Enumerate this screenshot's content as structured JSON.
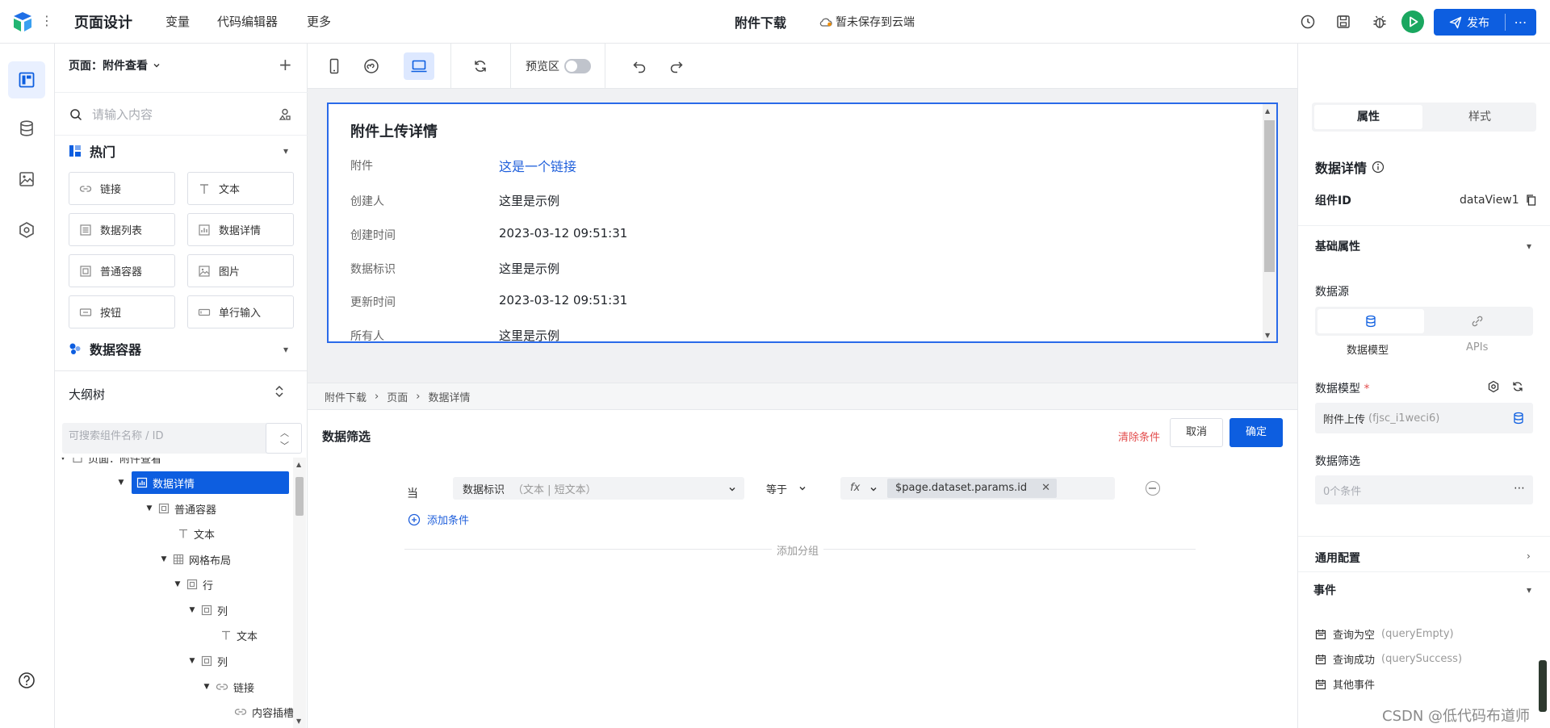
{
  "topbar": {
    "title": "页面设计",
    "menus": [
      "变量",
      "代码编辑器",
      "更多"
    ],
    "page_name": "附件下载",
    "save_status": "暂未保存到云端",
    "publish_label": "发布"
  },
  "panel": {
    "page_select": "页面：附件查看",
    "search_placeholder": "请输入内容",
    "hot_title": "热门",
    "components": [
      "链接",
      "文本",
      "数据列表",
      "数据详情",
      "普通容器",
      "图片",
      "按钮",
      "单行输入"
    ],
    "data_container_title": "数据容器",
    "outline_title": "大纲树",
    "tree_search_placeholder": "可搜索组件名称 / ID",
    "tree": [
      {
        "label": "页面：附件查看"
      },
      {
        "label": "数据详情"
      },
      {
        "label": "普通容器"
      },
      {
        "label": "文本"
      },
      {
        "label": "网格布局"
      },
      {
        "label": "行"
      },
      {
        "label": "列"
      },
      {
        "label": "文本"
      },
      {
        "label": "列"
      },
      {
        "label": "链接"
      },
      {
        "label": "内容插槽"
      }
    ]
  },
  "toolbar": {
    "preview_label": "预览区"
  },
  "card": {
    "title": "附件上传详情",
    "rows": [
      {
        "label": "附件",
        "value": "这是一个链接"
      },
      {
        "label": "创建人",
        "value": "这里是示例"
      },
      {
        "label": "创建时间",
        "value": "2023-03-12 09:51:31"
      },
      {
        "label": "数据标识",
        "value": "这里是示例"
      },
      {
        "label": "更新时间",
        "value": "2023-03-12 09:51:31"
      },
      {
        "label": "所有人",
        "value": "这里是示例"
      }
    ]
  },
  "breadcrumb": [
    "附件下载",
    "页面",
    "数据详情"
  ],
  "filter": {
    "title": "数据筛选",
    "clear_label": "清除条件",
    "cancel_label": "取消",
    "ok_label": "确定",
    "when_label": "当",
    "field": "数据标识",
    "field_type": "（文本 | 短文本）",
    "operator": "等于",
    "fx_label": "fx",
    "value": "$page.dataset.params.id",
    "add_condition": "添加条件",
    "add_group": "添加分组"
  },
  "props": {
    "tabs": [
      "属性",
      "样式"
    ],
    "title": "数据详情",
    "component_id_label": "组件ID",
    "component_id": "dataView1",
    "basic_section": "基础属性",
    "datasource_label": "数据源",
    "datasource_tabs": [
      "数据模型",
      "APIs"
    ],
    "model_label": "数据模型",
    "required_mark": "*",
    "model_value": "附件上传",
    "model_code": "(fjsc_i1weci6)",
    "data_filter_label": "数据筛选",
    "filter_value": "0个条件",
    "general_section": "通用配置",
    "events_section": "事件",
    "events": [
      {
        "name": "查询为空",
        "code": "(queryEmpty)"
      },
      {
        "name": "查询成功",
        "code": "(querySuccess)"
      },
      {
        "name": "其他事件",
        "code": ""
      }
    ]
  },
  "watermark": "CSDN @低代码布道师",
  "colors": {
    "primary": "#0d5ee0",
    "link": "#1f5fdb",
    "danger": "#e34d4d",
    "run": "#1aa760"
  }
}
